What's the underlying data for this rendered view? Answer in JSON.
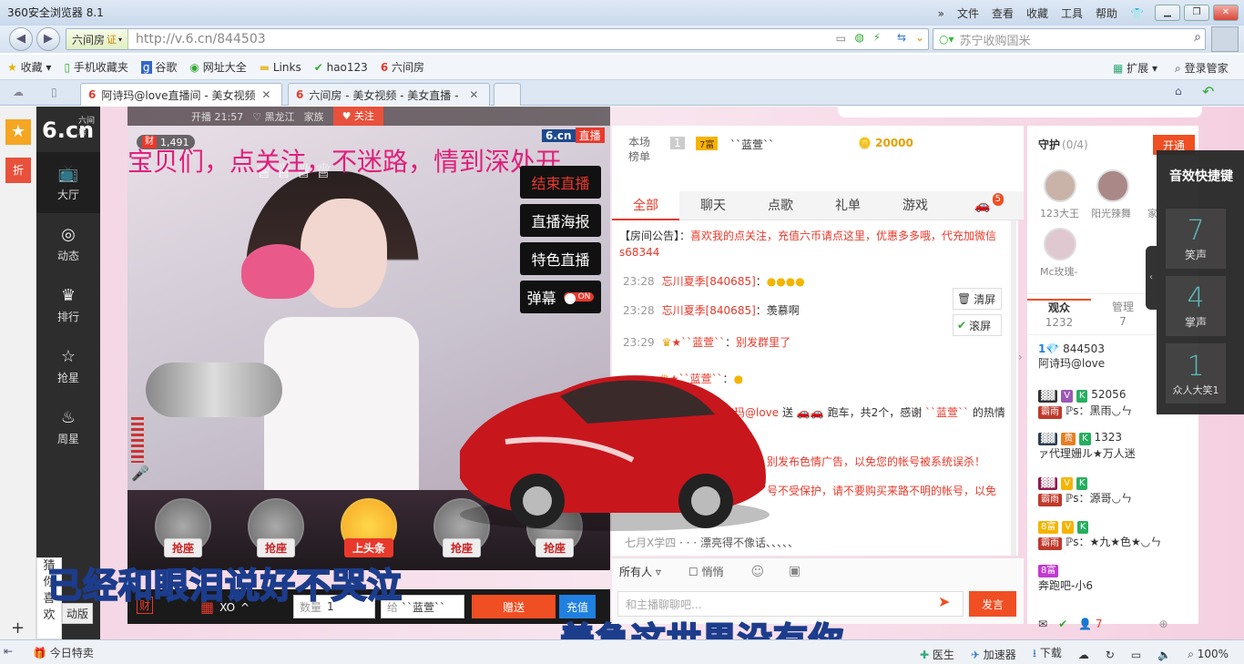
{
  "browser": {
    "title": "360安全浏览器 8.1",
    "menus": [
      "文件",
      "查看",
      "收藏",
      "工具",
      "帮助"
    ],
    "site_label": "六间房",
    "cert_label": "证",
    "url": "http://v.6.cn/844503",
    "search_placeholder": "苏宁收购国米",
    "bookmarks": [
      "收藏",
      "手机收藏夹",
      "谷歌",
      "网址大全",
      "Links",
      "hao123",
      "六间房"
    ],
    "bookmarks_right": [
      "扩展",
      "登录管家"
    ],
    "tabs": [
      {
        "label": "阿诗玛@love直播间 - 美女视频"
      },
      {
        "label": "六间房 - 美女视频 - 美女直播 -"
      }
    ],
    "status_left": "今日特卖",
    "status_items": [
      "医生",
      "加速器",
      "下载"
    ],
    "zoom": "100%"
  },
  "sidenav": {
    "logo": "6.cn",
    "logo_sub": "六间房",
    "items": [
      "大厅",
      "动态",
      "排行",
      "抢星",
      "周星"
    ],
    "left_strip": [
      "折"
    ]
  },
  "room": {
    "started": "开播 21:57",
    "location": "黑龙江",
    "family": "家族",
    "follow": "关注",
    "viewer_count": "1,491",
    "wealth_icon": "财",
    "brand": "6.cn",
    "live_tag": "直播",
    "marquee": "宝贝们，点关注，不迷路，情到深处开",
    "buttons": [
      "结束直播",
      "直播海报",
      "特色直播"
    ],
    "danmu_label": "弹幕",
    "danmu_state": "ON",
    "seats": [
      "抢座",
      "抢座",
      "上头条",
      "抢座",
      "抢座"
    ],
    "gift_user": "XO",
    "quantity_label": "数量",
    "quantity": "1",
    "give_to_label": "给",
    "give_to": "``蓝萱``",
    "send_gift": "赠送",
    "recharge": "充值",
    "promo": [
      "猜",
      "你",
      "喜",
      "欢"
    ],
    "promo_tag": "动版"
  },
  "ranking": {
    "title": "本场榜单",
    "rank": "1",
    "user": "``蓝萱``",
    "level_badge": "7富",
    "coins": "20000"
  },
  "chat": {
    "tabs": [
      "全部",
      "聊天",
      "点歌",
      "礼单",
      "游戏"
    ],
    "car_badge": "5",
    "notice_prefix": "【房间公告】：",
    "notice": "喜欢我的点关注，充值六币请点这里，优惠多多哦，代充加微信s68344",
    "messages": [
      {
        "time": "23:28",
        "user": "忘川夏季[840685]",
        "text": ""
      },
      {
        "time": "23:28",
        "user": "忘川夏季[840685]",
        "text": "羡慕啊"
      },
      {
        "time": "23:29",
        "user": "``蓝萱``",
        "text": "别发群里了"
      },
      {
        "time": "",
        "user": "``蓝萱``",
        "text": ""
      }
    ],
    "gift_msg_user": "阿诗玛@love",
    "gift_msg": "送",
    "gift_msg_tail": "跑车，共2个，感谢",
    "gift_msg_from": "``蓝萱``",
    "gift_msg_end": "的热情",
    "warn1": "别发布色情广告，以免您的帐号被系统误杀！",
    "warn2": "号不受保护，请不要购买来路不明的帐号，以免",
    "last_msg": "漂亮得不像话、、、、、",
    "last_msg_prefix": "七月X学四",
    "clear_label": "清屏",
    "lock_label": "滚屏",
    "recipient": "所有人",
    "whisper": "悄悄",
    "input_placeholder": "和主播聊聊吧...",
    "send": "发言"
  },
  "guard": {
    "title": "守护",
    "count": "(0/4)",
    "open": "开通",
    "members": [
      "123大王",
      "阳光辣舞",
      "家",
      "Mc玫瑰-"
    ],
    "audience_tab": "观众",
    "audience_count": "1232",
    "admin_tab": "管理",
    "admin_count": "7",
    "users": [
      {
        "rank": "1",
        "id": "844503",
        "name": "阿诗玛@love"
      },
      {
        "id": "52056",
        "name": "ℙs：黑雨◡ㄣ"
      },
      {
        "id": "1323",
        "name": "ァ代理姗ル★万人迷"
      },
      {
        "id": "",
        "name": "ℙs：源哥◡ㄣ"
      },
      {
        "id": "",
        "name": "ℙs：★九★色★◡ㄣ"
      },
      {
        "id": "",
        "name": "奔跑吧-小6"
      }
    ],
    "online_count": "7"
  },
  "sound": {
    "title": "音效快捷键",
    "items": [
      {
        "key": "7",
        "label": "笑声"
      },
      {
        "key": "4",
        "label": "掌声"
      },
      {
        "key": "1",
        "label": "众人大笑1"
      }
    ]
  },
  "subtitles": {
    "line1": "已经和眼泪说好不哭泣",
    "line2": "着急这世界没有你"
  }
}
